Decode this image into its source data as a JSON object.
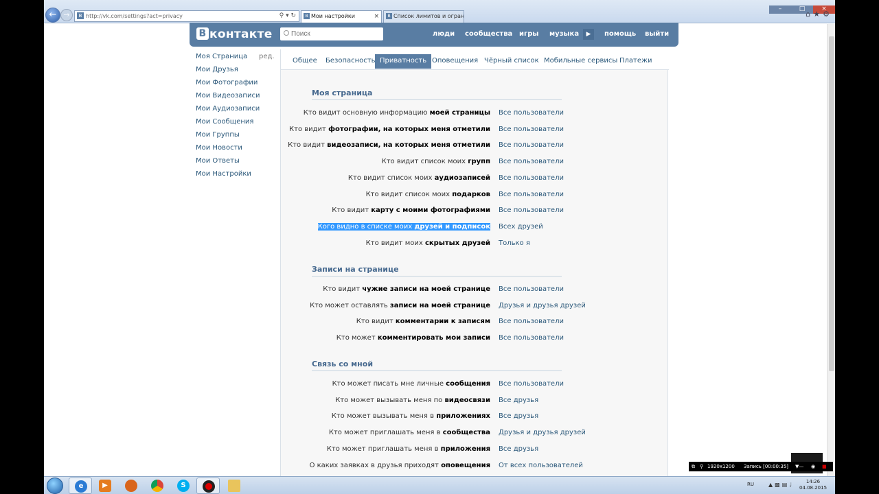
{
  "browser": {
    "address": "http://vk.com/settings?act=privacy",
    "tabs": [
      {
        "title": "Мои настройки"
      },
      {
        "title": "Список лимитов и ограниче..."
      }
    ]
  },
  "header": {
    "logo": "контакте",
    "logo_letter": "В",
    "search_placeholder": "Поиск",
    "links": [
      "люди",
      "сообщества",
      "игры",
      "музыка",
      "помощь",
      "выйти"
    ]
  },
  "left_menu": {
    "edit": "ред.",
    "items": [
      "Моя Страница",
      "Мои Друзья",
      "Мои Фотографии",
      "Мои Видеозаписи",
      "Мои Аудиозаписи",
      "Мои Сообщения",
      "Мои Группы",
      "Мои Новости",
      "Мои Ответы",
      "Мои Настройки"
    ]
  },
  "settings_tabs": [
    "Общее",
    "Безопасность",
    "Приватность",
    "Оповещения",
    "Чёрный список",
    "Мобильные сервисы",
    "Платежи"
  ],
  "active_tab": "Приватность",
  "sections": [
    {
      "title": "Моя страница",
      "rows": [
        {
          "pre": "Кто видит основную информацию ",
          "bold": "моей страницы",
          "value": "Все пользователи"
        },
        {
          "pre": "Кто видит ",
          "bold": "фотографии, на которых меня отметили",
          "value": "Все пользователи"
        },
        {
          "pre": "Кто видит ",
          "bold": "видеозаписи, на которых меня отметили",
          "value": "Все пользователи"
        },
        {
          "pre": "Кто видит список моих ",
          "bold": "групп",
          "value": "Все пользователи"
        },
        {
          "pre": "Кто видит список моих ",
          "bold": "аудиозаписей",
          "value": "Все пользователи"
        },
        {
          "pre": "Кто видит список моих ",
          "bold": "подарков",
          "value": "Все пользователи"
        },
        {
          "pre": "Кто видит ",
          "bold": "карту с моими фотографиями",
          "value": "Все пользователи"
        },
        {
          "pre": "Кого видно в списке моих ",
          "bold": "друзей и подписок",
          "value": "Всех друзей"
        },
        {
          "pre": "Кто видит моих ",
          "bold": "скрытых друзей",
          "value": "Только я"
        }
      ]
    },
    {
      "title": "Записи на странице",
      "rows": [
        {
          "pre": "Кто видит ",
          "bold": "чужие записи на моей странице",
          "value": "Все пользователи"
        },
        {
          "pre": "Кто может оставлять ",
          "bold": "записи на моей странице",
          "value": "Друзья и друзья друзей"
        },
        {
          "pre": "Кто видит ",
          "bold": "комментарии к записям",
          "value": "Все пользователи"
        },
        {
          "pre": "Кто может ",
          "bold": "комментировать мои записи",
          "value": "Все пользователи"
        }
      ]
    },
    {
      "title": "Связь со мной",
      "rows": [
        {
          "pre": "Кто может писать мне личные ",
          "bold": "сообщения",
          "value": "Все пользователи"
        },
        {
          "pre": "Кто может вызывать меня по ",
          "bold": "видеосвязи",
          "value": "Все друзья"
        },
        {
          "pre": "Кто может вызывать меня в ",
          "bold": "приложениях",
          "value": "Все друзья"
        },
        {
          "pre": "Кто может приглашать меня в ",
          "bold": "сообщества",
          "value": "Друзья и друзья друзей"
        },
        {
          "pre": "Кто может приглашать меня в ",
          "bold": "приложения",
          "value": "Все друзья"
        },
        {
          "pre": "О каких заявках в друзья приходят ",
          "bold": "оповещения",
          "value": "От всех пользователей"
        }
      ]
    }
  ],
  "recorder": {
    "resolution": "1920x1200",
    "status": "Запись [00:00:35]"
  },
  "tray": {
    "lang": "RU",
    "time": "14:26",
    "date": "04.08.2015"
  },
  "colors": {
    "vk_blue": "#597da3",
    "link": "#2b587a",
    "section_title": "#45688e",
    "selection": "#3399ff"
  }
}
